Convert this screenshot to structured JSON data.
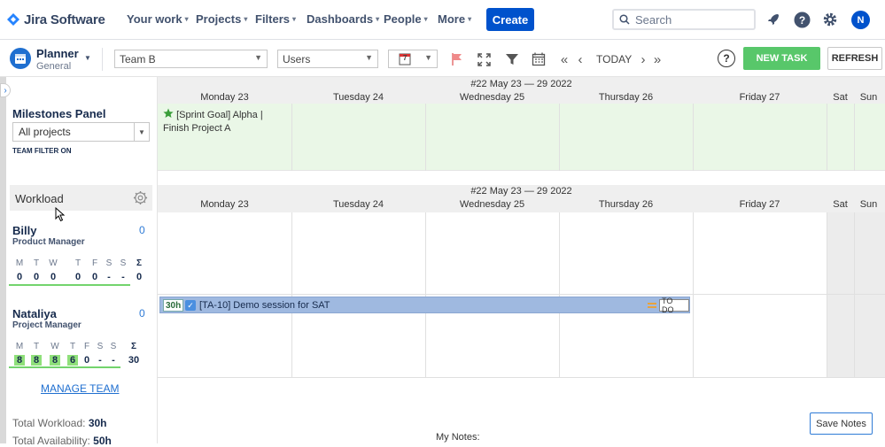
{
  "topnav": {
    "app_name": "Jira Software",
    "items": [
      {
        "label": "Your work"
      },
      {
        "label": "Projects"
      },
      {
        "label": "Filters"
      },
      {
        "label": "Dashboards"
      },
      {
        "label": "People"
      },
      {
        "label": "More"
      }
    ],
    "create_label": "Create",
    "search_placeholder": "Search",
    "avatar_initial": "N"
  },
  "toolbar": {
    "planner_title": "Planner",
    "planner_subtitle": "General",
    "team_select": "Team B",
    "users_select": "Users",
    "calendar_day": "7",
    "today_label": "TODAY",
    "new_task_label": "NEW TASK",
    "refresh_label": "REFRESH"
  },
  "milestones": {
    "title": "Milestones Panel",
    "project_select": "All projects",
    "team_filter": "TEAM FILTER ON",
    "week_label": "#22 May 23 — 29 2022",
    "items": [
      {
        "line1": "[Sprint Goal] Alpha |",
        "line2": "Finish Project A"
      }
    ]
  },
  "calendar": {
    "days": [
      "Monday 23",
      "Tuesday 24",
      "Wednesday 25",
      "Thursday 26",
      "Friday 27",
      "Sat",
      "Sun"
    ]
  },
  "workload": {
    "title": "Workload",
    "week_label": "#22 May 23 — 29 2022",
    "weekday_letters": [
      "M",
      "T",
      "W",
      "T",
      "F",
      "S",
      "S",
      "Σ"
    ],
    "members": [
      {
        "name": "Billy",
        "role": "Product Manager",
        "count": "0",
        "values": [
          "0",
          "0",
          "0",
          "0",
          "0",
          "-",
          "-",
          "0"
        ]
      },
      {
        "name": "Nataliya",
        "role": "Project Manager",
        "count": "0",
        "values": [
          "8",
          "8",
          "8",
          "6",
          "0",
          "-",
          "-",
          "30"
        ]
      }
    ],
    "manage_team_label": "MANAGE TEAM",
    "total_workload_label": "Total Workload:",
    "total_workload_value": "30h",
    "total_availability_label": "Total Availability:",
    "total_availability_value": "50h"
  },
  "task": {
    "hours": "30h",
    "label": "[TA-10] Demo session for SAT",
    "status": "TO DO"
  },
  "notes": {
    "label": "My Notes:",
    "save_label": "Save Notes"
  },
  "colors": {
    "jira_blue": "#0052cc",
    "new_task_green": "#58c76a",
    "milestone_bg": "#eaf7e7",
    "task_bar": "#9fb9e0",
    "workload_highlight": "#8fe07a"
  }
}
